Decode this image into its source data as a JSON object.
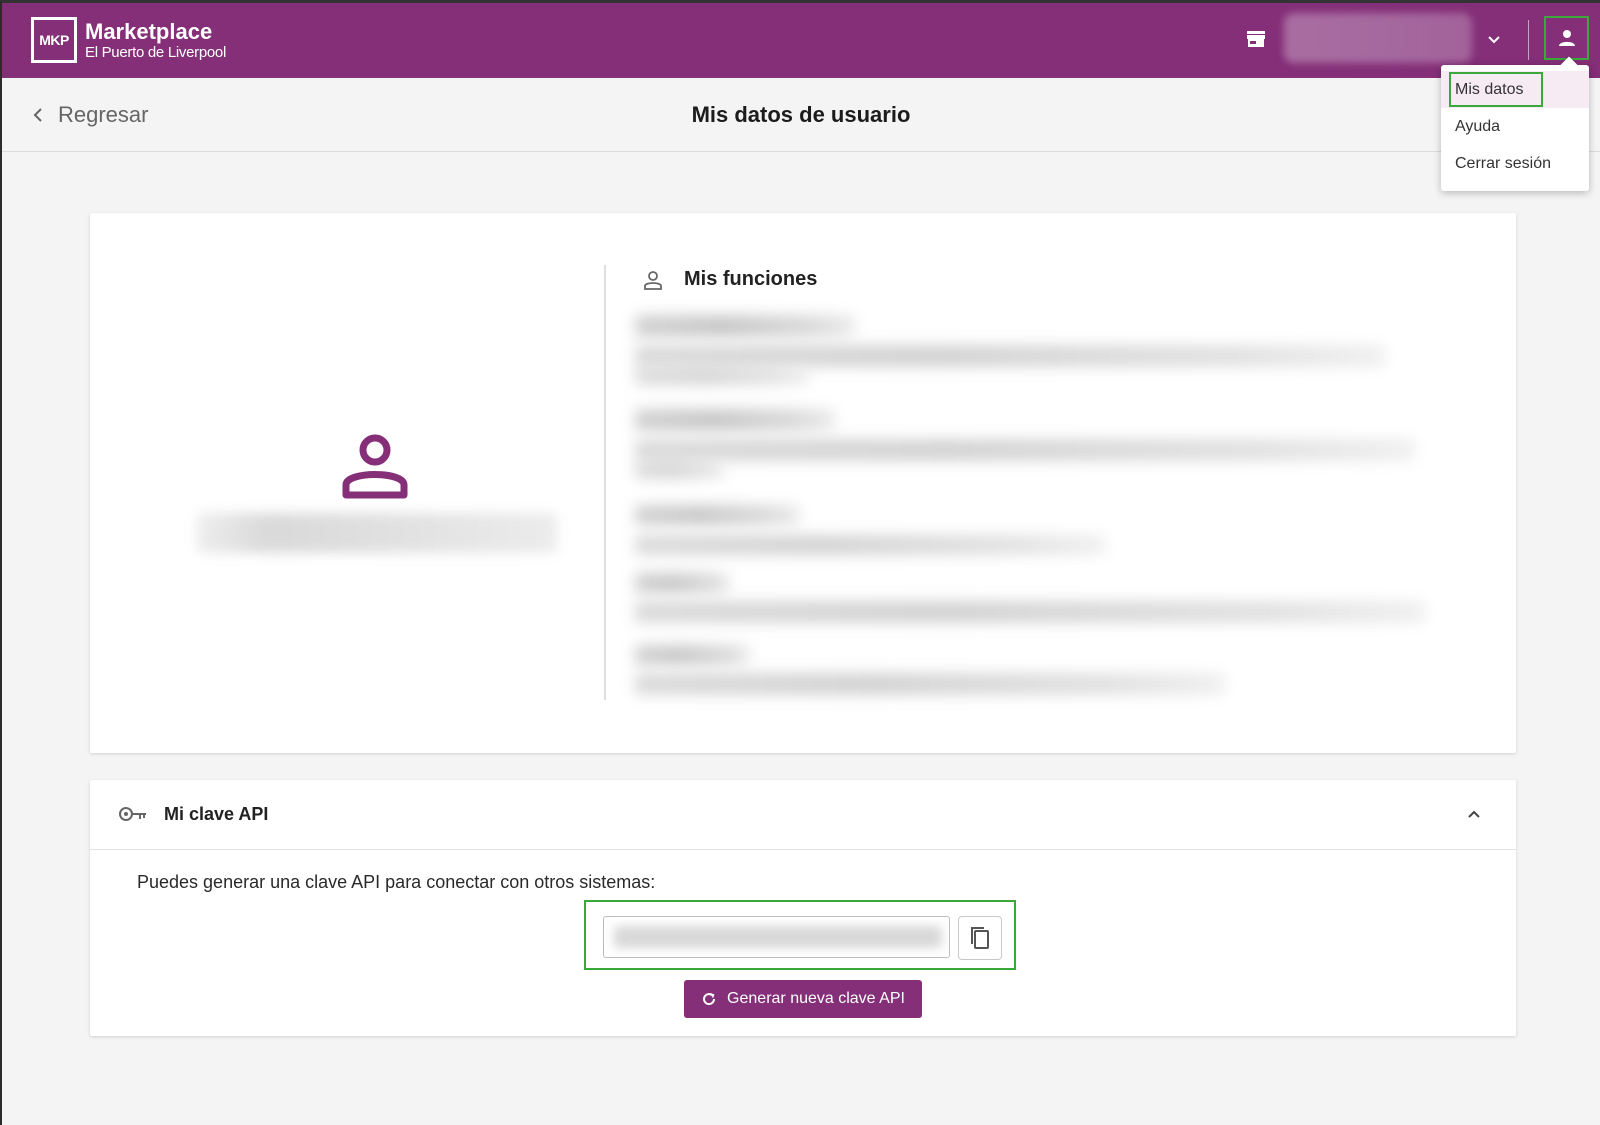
{
  "header": {
    "logo_mark": "MKP",
    "brand_title": "Marketplace",
    "brand_subtitle": "El Puerto de Liverpool",
    "store_icon": "store-icon",
    "chevron_icon": "chevron-down-icon",
    "user_icon": "person-icon"
  },
  "subheader": {
    "back_label": "Regresar",
    "page_title": "Mis datos de usuario"
  },
  "user_menu": {
    "items": [
      {
        "label": "Mis datos",
        "active": true
      },
      {
        "label": "Ayuda",
        "active": false
      },
      {
        "label": "Cerrar sesión",
        "active": false
      }
    ]
  },
  "profile": {
    "avatar_icon": "person-outline-icon",
    "functions_title": "Mis funciones"
  },
  "api_key": {
    "title": "Mi clave API",
    "description": "Puedes generar una clave API para conectar con otros sistemas:",
    "copy_icon": "copy-icon",
    "generate_label": "Generar nueva clave API",
    "refresh_icon": "refresh-icon"
  },
  "colors": {
    "brand": "#842f78",
    "highlight": "#3aa83a",
    "background": "#f4f4f4"
  }
}
